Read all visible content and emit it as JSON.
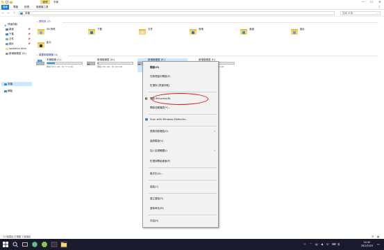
{
  "titlebar": {
    "manage_tab": "管理",
    "title": "本機",
    "drive_tools": "磁碟機工具",
    "minimize": "—",
    "maximize": "☐",
    "close": "✕"
  },
  "ribbon": {
    "tabs": [
      "檔案",
      "電腦",
      "檢視",
      "磁碟機工具"
    ]
  },
  "address": {
    "path": "本機",
    "search_placeholder": "搜尋 本機",
    "back": "←",
    "forward": "→",
    "up": "↑"
  },
  "sidebar": {
    "items": [
      {
        "label": "快速存取"
      },
      {
        "label": "桌面"
      },
      {
        "label": "下載"
      },
      {
        "label": "文件"
      },
      {
        "label": "圖片"
      },
      {
        "label": "socket.io-html"
      },
      {
        "label": "新增磁碟區 (D:)"
      },
      {
        "label": "本機"
      },
      {
        "label": "網路"
      }
    ]
  },
  "content": {
    "folders_header": "資料夾 (7)",
    "folders": [
      {
        "label": "3D 物件"
      },
      {
        "label": "下載"
      },
      {
        "label": "文件"
      },
      {
        "label": "音樂"
      },
      {
        "label": "桌面"
      },
      {
        "label": "圖片"
      },
      {
        "label": "影片"
      }
    ],
    "drives_header": "裝置和磁碟機 (4)",
    "drives": [
      {
        "name": "本機磁碟 (C:)",
        "free": "剩餘 60.4 GB，共 77.0 GB",
        "used_fraction": 0.22
      },
      {
        "name": "新增磁碟區 (D:)",
        "free": "剩餘 201 GB，共 204 GB",
        "used_fraction": 0.02
      },
      {
        "name": "新增磁碟區 (E:)",
        "free": "剩餘 201 GB，共 204 GB",
        "used_fraction": 0.02
      },
      {
        "name": "新增磁碟區 (F:)",
        "free": "剩餘 201 GB，共 204 GB",
        "used_fraction": 0.02
      }
    ]
  },
  "context_menu": {
    "items": [
      {
        "label": "開啟(O)"
      },
      {
        "label": "在新視窗中開啟(E)"
      },
      {
        "label": "釘選到 [快速存取]"
      },
      {
        "label": "開啟 BitLocker(B)"
      },
      {
        "label": "開啟自動播放(Y)..."
      },
      {
        "label": "Scan with Windows Defender..."
      },
      {
        "label": "授與存取權給(G)"
      },
      {
        "label": "還原舊版(V)"
      },
      {
        "label": "加入至媒體櫃(I)"
      },
      {
        "label": "釘選到開始畫面(P)"
      },
      {
        "label": "格式化(A)..."
      },
      {
        "label": "複製(C)"
      },
      {
        "label": "建立捷徑(S)"
      },
      {
        "label": "重新命名(M)"
      },
      {
        "label": "內容(R)"
      }
    ]
  },
  "statusbar": {
    "text": "11 個項目    已選取 1 個項目"
  },
  "taskbar": {
    "time": "14:32",
    "date": "26/1/2020",
    "ime": "中",
    "ime2": "英"
  },
  "colors": {
    "accent": "#1979ca",
    "selection": "#cce8ff",
    "annotation": "#d8201c",
    "drive_fill": "#26a0da"
  }
}
